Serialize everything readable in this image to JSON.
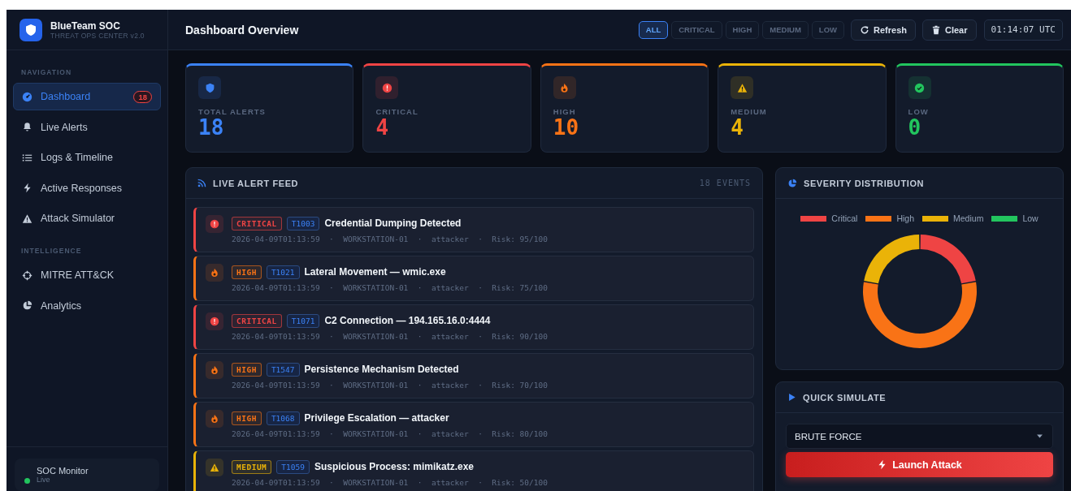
{
  "sidebar": {
    "brand": {
      "title": "BlueTeam SOC",
      "subtitle": "THREAT OPS CENTER v2.0"
    },
    "sections": [
      {
        "heading": "NAVIGATION",
        "items": [
          {
            "label": "Dashboard",
            "selected": true,
            "badge": "18"
          },
          {
            "label": "Live Alerts",
            "selected": false
          },
          {
            "label": "Logs & Timeline",
            "selected": false
          },
          {
            "label": "Active Responses",
            "selected": false
          },
          {
            "label": "Attack Simulator",
            "selected": false
          }
        ]
      },
      {
        "heading": "INTELLIGENCE",
        "items": [
          {
            "label": "MITRE ATT&CK",
            "selected": false
          },
          {
            "label": "Analytics",
            "selected": false
          }
        ]
      }
    ],
    "status": {
      "title": "SOC Monitor",
      "state": "Live",
      "online": true
    }
  },
  "header": {
    "title": "Dashboard Overview",
    "filters": [
      {
        "label": "ALL",
        "selected": true
      },
      {
        "label": "CRITICAL",
        "selected": false
      },
      {
        "label": "HIGH",
        "selected": false
      },
      {
        "label": "MEDIUM",
        "selected": false
      },
      {
        "label": "LOW",
        "selected": false
      }
    ],
    "buttons": [
      {
        "label": "Refresh",
        "kind": "refresh"
      },
      {
        "label": "Clear",
        "kind": "clear"
      }
    ],
    "clock": "01:14:07 UTC"
  },
  "stats": [
    {
      "kind": "total",
      "label": "TOTAL ALERTS",
      "value": "18"
    },
    {
      "kind": "critical",
      "label": "CRITICAL",
      "value": "4"
    },
    {
      "kind": "high",
      "label": "HIGH",
      "value": "10"
    },
    {
      "kind": "medium",
      "label": "MEDIUM",
      "value": "4"
    },
    {
      "kind": "low",
      "label": "LOW",
      "value": "0"
    }
  ],
  "alert_feed": {
    "title": "LIVE ALERT FEED",
    "count": "18 EVENTS",
    "alerts": [
      {
        "kind": "critical",
        "badge": "CRITICAL",
        "technique": "T1003",
        "title": "Credential Dumping Detected",
        "meta": "2026-04-09T01:13:59  ·  WORKSTATION-01  ·  attacker  ·  Risk: 95/100"
      },
      {
        "kind": "high",
        "badge": "HIGH",
        "technique": "T1021",
        "title": "Lateral Movement — wmic.exe",
        "meta": "2026-04-09T01:13:59  ·  WORKSTATION-01  ·  attacker  ·  Risk: 75/100"
      },
      {
        "kind": "critical",
        "badge": "CRITICAL",
        "technique": "T1071",
        "title": "C2 Connection — 194.165.16.0:4444",
        "meta": "2026-04-09T01:13:59  ·  WORKSTATION-01  ·  attacker  ·  Risk: 90/100"
      },
      {
        "kind": "high",
        "badge": "HIGH",
        "technique": "T1547",
        "title": "Persistence Mechanism Detected",
        "meta": "2026-04-09T01:13:59  ·  WORKSTATION-01  ·  attacker  ·  Risk: 70/100"
      },
      {
        "kind": "high",
        "badge": "HIGH",
        "technique": "T1068",
        "title": "Privilege Escalation — attacker",
        "meta": "2026-04-09T01:13:59  ·  WORKSTATION-01  ·  attacker  ·  Risk: 80/100"
      },
      {
        "kind": "medium",
        "badge": "MEDIUM",
        "technique": "T1059",
        "title": "Suspicious Process: mimikatz.exe",
        "meta": "2026-04-09T01:13:59  ·  WORKSTATION-01  ·  attacker  ·  Risk: 50/100"
      }
    ]
  },
  "severity_distribution": {
    "title": "SEVERITY DISTRIBUTION",
    "chart_data": {
      "type": "donut",
      "categories": [
        "Critical",
        "High",
        "Medium",
        "Low"
      ],
      "colors": [
        "#ef4444",
        "#f97316",
        "#eab308",
        "#22c55e"
      ],
      "legend": "top",
      "values": [
        22.2,
        55.6,
        22.2,
        0
      ]
    }
  },
  "quick_simulate": {
    "title": "QUICK SIMULATE",
    "attack_type": "BRUTE FORCE",
    "button": "Launch Attack"
  }
}
